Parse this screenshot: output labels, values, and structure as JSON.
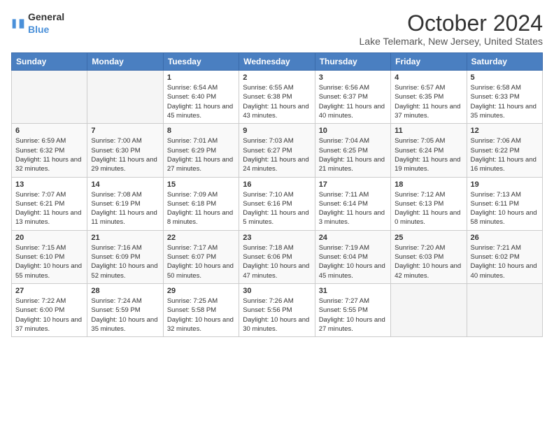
{
  "logo": {
    "general": "General",
    "blue": "Blue"
  },
  "header": {
    "month": "October 2024",
    "location": "Lake Telemark, New Jersey, United States"
  },
  "days_of_week": [
    "Sunday",
    "Monday",
    "Tuesday",
    "Wednesday",
    "Thursday",
    "Friday",
    "Saturday"
  ],
  "weeks": [
    [
      {
        "day": null,
        "info": null
      },
      {
        "day": null,
        "info": null
      },
      {
        "day": "1",
        "info": "Sunrise: 6:54 AM\nSunset: 6:40 PM\nDaylight: 11 hours and 45 minutes."
      },
      {
        "day": "2",
        "info": "Sunrise: 6:55 AM\nSunset: 6:38 PM\nDaylight: 11 hours and 43 minutes."
      },
      {
        "day": "3",
        "info": "Sunrise: 6:56 AM\nSunset: 6:37 PM\nDaylight: 11 hours and 40 minutes."
      },
      {
        "day": "4",
        "info": "Sunrise: 6:57 AM\nSunset: 6:35 PM\nDaylight: 11 hours and 37 minutes."
      },
      {
        "day": "5",
        "info": "Sunrise: 6:58 AM\nSunset: 6:33 PM\nDaylight: 11 hours and 35 minutes."
      }
    ],
    [
      {
        "day": "6",
        "info": "Sunrise: 6:59 AM\nSunset: 6:32 PM\nDaylight: 11 hours and 32 minutes."
      },
      {
        "day": "7",
        "info": "Sunrise: 7:00 AM\nSunset: 6:30 PM\nDaylight: 11 hours and 29 minutes."
      },
      {
        "day": "8",
        "info": "Sunrise: 7:01 AM\nSunset: 6:29 PM\nDaylight: 11 hours and 27 minutes."
      },
      {
        "day": "9",
        "info": "Sunrise: 7:03 AM\nSunset: 6:27 PM\nDaylight: 11 hours and 24 minutes."
      },
      {
        "day": "10",
        "info": "Sunrise: 7:04 AM\nSunset: 6:25 PM\nDaylight: 11 hours and 21 minutes."
      },
      {
        "day": "11",
        "info": "Sunrise: 7:05 AM\nSunset: 6:24 PM\nDaylight: 11 hours and 19 minutes."
      },
      {
        "day": "12",
        "info": "Sunrise: 7:06 AM\nSunset: 6:22 PM\nDaylight: 11 hours and 16 minutes."
      }
    ],
    [
      {
        "day": "13",
        "info": "Sunrise: 7:07 AM\nSunset: 6:21 PM\nDaylight: 11 hours and 13 minutes."
      },
      {
        "day": "14",
        "info": "Sunrise: 7:08 AM\nSunset: 6:19 PM\nDaylight: 11 hours and 11 minutes."
      },
      {
        "day": "15",
        "info": "Sunrise: 7:09 AM\nSunset: 6:18 PM\nDaylight: 11 hours and 8 minutes."
      },
      {
        "day": "16",
        "info": "Sunrise: 7:10 AM\nSunset: 6:16 PM\nDaylight: 11 hours and 5 minutes."
      },
      {
        "day": "17",
        "info": "Sunrise: 7:11 AM\nSunset: 6:14 PM\nDaylight: 11 hours and 3 minutes."
      },
      {
        "day": "18",
        "info": "Sunrise: 7:12 AM\nSunset: 6:13 PM\nDaylight: 11 hours and 0 minutes."
      },
      {
        "day": "19",
        "info": "Sunrise: 7:13 AM\nSunset: 6:11 PM\nDaylight: 10 hours and 58 minutes."
      }
    ],
    [
      {
        "day": "20",
        "info": "Sunrise: 7:15 AM\nSunset: 6:10 PM\nDaylight: 10 hours and 55 minutes."
      },
      {
        "day": "21",
        "info": "Sunrise: 7:16 AM\nSunset: 6:09 PM\nDaylight: 10 hours and 52 minutes."
      },
      {
        "day": "22",
        "info": "Sunrise: 7:17 AM\nSunset: 6:07 PM\nDaylight: 10 hours and 50 minutes."
      },
      {
        "day": "23",
        "info": "Sunrise: 7:18 AM\nSunset: 6:06 PM\nDaylight: 10 hours and 47 minutes."
      },
      {
        "day": "24",
        "info": "Sunrise: 7:19 AM\nSunset: 6:04 PM\nDaylight: 10 hours and 45 minutes."
      },
      {
        "day": "25",
        "info": "Sunrise: 7:20 AM\nSunset: 6:03 PM\nDaylight: 10 hours and 42 minutes."
      },
      {
        "day": "26",
        "info": "Sunrise: 7:21 AM\nSunset: 6:02 PM\nDaylight: 10 hours and 40 minutes."
      }
    ],
    [
      {
        "day": "27",
        "info": "Sunrise: 7:22 AM\nSunset: 6:00 PM\nDaylight: 10 hours and 37 minutes."
      },
      {
        "day": "28",
        "info": "Sunrise: 7:24 AM\nSunset: 5:59 PM\nDaylight: 10 hours and 35 minutes."
      },
      {
        "day": "29",
        "info": "Sunrise: 7:25 AM\nSunset: 5:58 PM\nDaylight: 10 hours and 32 minutes."
      },
      {
        "day": "30",
        "info": "Sunrise: 7:26 AM\nSunset: 5:56 PM\nDaylight: 10 hours and 30 minutes."
      },
      {
        "day": "31",
        "info": "Sunrise: 7:27 AM\nSunset: 5:55 PM\nDaylight: 10 hours and 27 minutes."
      },
      {
        "day": null,
        "info": null
      },
      {
        "day": null,
        "info": null
      }
    ]
  ]
}
